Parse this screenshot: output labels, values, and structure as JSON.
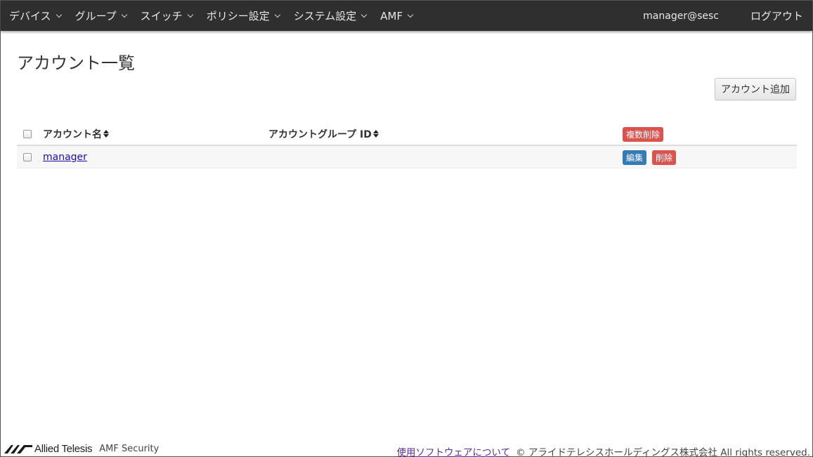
{
  "nav": {
    "items": [
      {
        "label": "デバイス"
      },
      {
        "label": "グループ"
      },
      {
        "label": "スイッチ"
      },
      {
        "label": "ポリシー設定"
      },
      {
        "label": "システム設定"
      },
      {
        "label": "AMF"
      }
    ],
    "user": "manager@sesc",
    "logout": "ログアウト"
  },
  "page": {
    "title": "アカウント一覧",
    "add_button": "アカウント追加"
  },
  "table": {
    "columns": {
      "name": "アカウント名",
      "group_id": "アカウントグループ ID"
    },
    "bulk_delete": "複数削除",
    "rows": [
      {
        "name": "manager",
        "group_id": "",
        "edit": "編集",
        "delete": "削除"
      }
    ]
  },
  "footer": {
    "brand": "Allied Telesis",
    "product": "AMF Security",
    "about_link": "使用ソフトウェアについて",
    "copyright": "© アライドテレシスホールディングス株式会社 All rights reserved."
  },
  "colors": {
    "navbar": "#2f2f2f",
    "danger": "#d9534f",
    "primary": "#337ab7",
    "link": "#1a0dab"
  }
}
